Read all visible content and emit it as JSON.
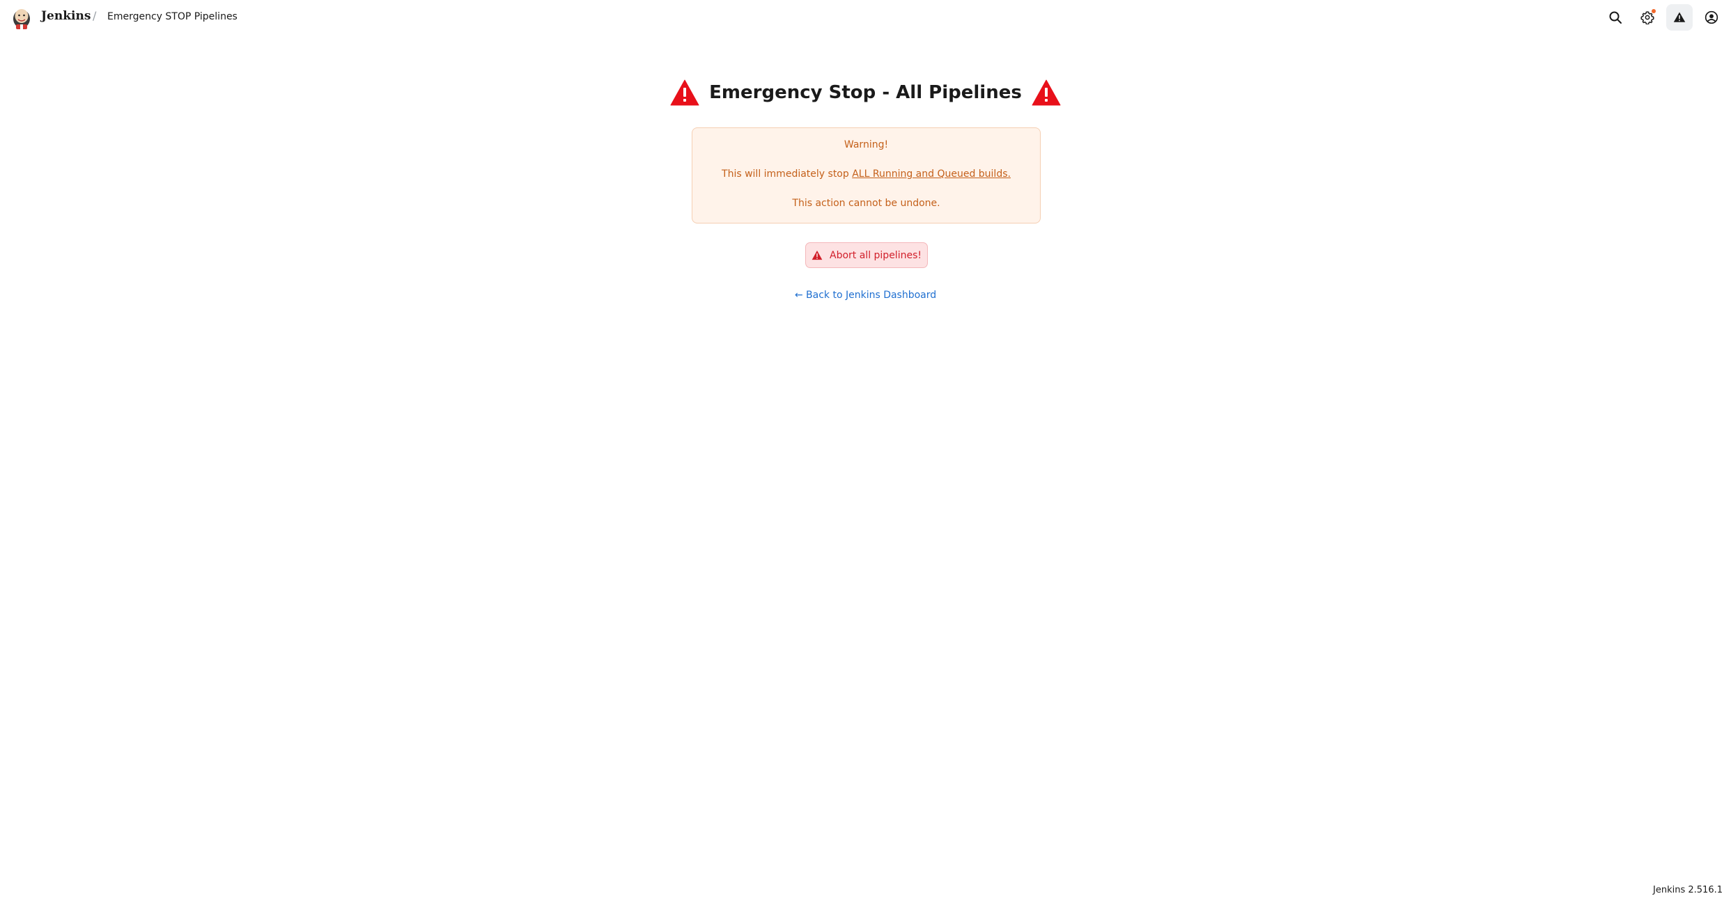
{
  "header": {
    "brand": "Jenkins",
    "separator": "/",
    "breadcrumb": "Emergency STOP Pipelines",
    "icons": [
      "search-icon",
      "settings-gear-icon",
      "warning-icon",
      "user-account-icon"
    ],
    "notification_dot_color": "#f0672a"
  },
  "main": {
    "title": "Emergency Stop - All Pipelines",
    "title_icon": "warning-triangle-icon",
    "warning": {
      "heading": "Warning!",
      "line_prefix": "This will immediately stop ",
      "line_link": "ALL Running and Queued builds.",
      "line_last": "This action cannot be undone."
    },
    "abort_button_label": "Abort all pipelines!",
    "back_link": "← Back to Jenkins Dashboard"
  },
  "footer": {
    "version": "Jenkins 2.516.1"
  },
  "colors": {
    "danger_red": "#e8101a",
    "warning_text": "#c4601a",
    "warning_bg": "#fff3ea",
    "link_blue": "#1f6fd0"
  }
}
